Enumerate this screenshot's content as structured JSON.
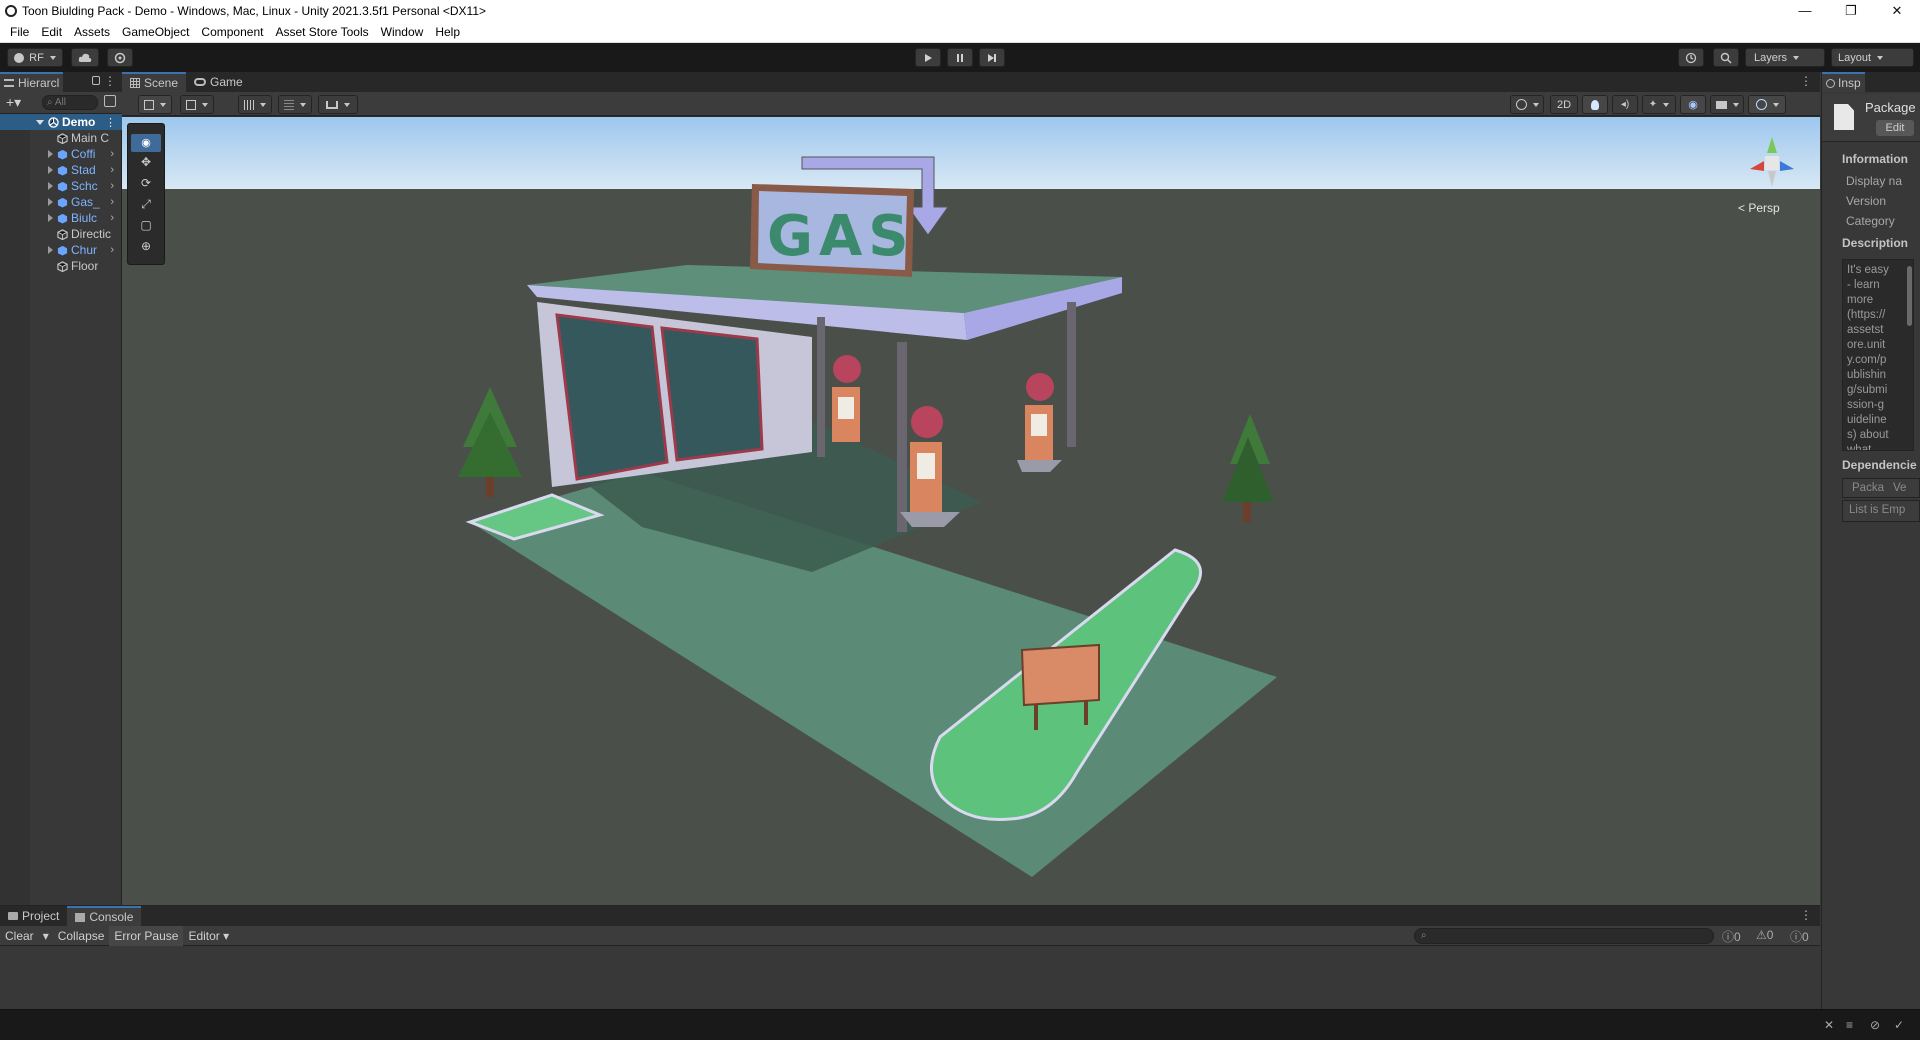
{
  "window": {
    "title": "Toon Biulding Pack - Demo - Windows, Mac, Linux - Unity 2021.3.5f1 Personal <DX11>",
    "controls": [
      "—",
      "❐",
      "✕"
    ]
  },
  "menu": [
    "File",
    "Edit",
    "Assets",
    "GameObject",
    "Component",
    "Asset Store Tools",
    "Window",
    "Help"
  ],
  "toolbar": {
    "account_label": "RF",
    "layers_label": "Layers",
    "layout_label": "Layout"
  },
  "hierarchy": {
    "tab_label": "Hierarchy",
    "tab_label_short": "Hierarcl",
    "search_placeholder": "All",
    "root": "Demo",
    "items": [
      {
        "label": "Main C",
        "prefab": false,
        "expandable": false
      },
      {
        "label": "Coffi",
        "prefab": true,
        "expandable": true
      },
      {
        "label": "Stad",
        "prefab": true,
        "expandable": true
      },
      {
        "label": "Schc",
        "prefab": true,
        "expandable": true
      },
      {
        "label": "Gas_",
        "prefab": true,
        "expandable": true
      },
      {
        "label": "Biulc",
        "prefab": true,
        "expandable": true
      },
      {
        "label": "Directic",
        "prefab": false,
        "expandable": false
      },
      {
        "label": "Chur",
        "prefab": true,
        "expandable": true
      },
      {
        "label": "Floor",
        "prefab": false,
        "expandable": false
      }
    ]
  },
  "scene": {
    "tabs": [
      "Scene",
      "Game"
    ],
    "mode_2d": "2D",
    "persp_label": "< Persp",
    "sign_text": "GAS"
  },
  "inspector": {
    "tab_label": "Insp",
    "asset_name": "Package",
    "edit_label": "Edit",
    "information_header": "Information",
    "fields": [
      "Display na",
      "Version",
      "Category"
    ],
    "description_header": "Description",
    "description_lines": [
      "It's easy",
      "- learn",
      "more",
      "(https://",
      "assetst",
      "ore.unit",
      "y.com/p",
      "ublishin",
      "g/submi",
      "ssion-g",
      "uideline",
      "s) about",
      "what"
    ],
    "dependencies_header": "Dependencie",
    "dep_columns": [
      "Packa",
      "Ve"
    ],
    "list_empty": "List is Emp"
  },
  "console": {
    "tabs": [
      "Project",
      "Console"
    ],
    "buttons": [
      "Clear",
      "Collapse",
      "Error Pause",
      "Editor"
    ],
    "counts": {
      "info": "0",
      "warn": "0",
      "error": "0"
    }
  },
  "colors": {
    "accent": "#3a72b0",
    "prefab_text": "#7fb3ff",
    "ground": "#4a5049",
    "pad": "#5b8a76",
    "grass": "#5cc27a",
    "canopy": "#a9a8e6"
  }
}
